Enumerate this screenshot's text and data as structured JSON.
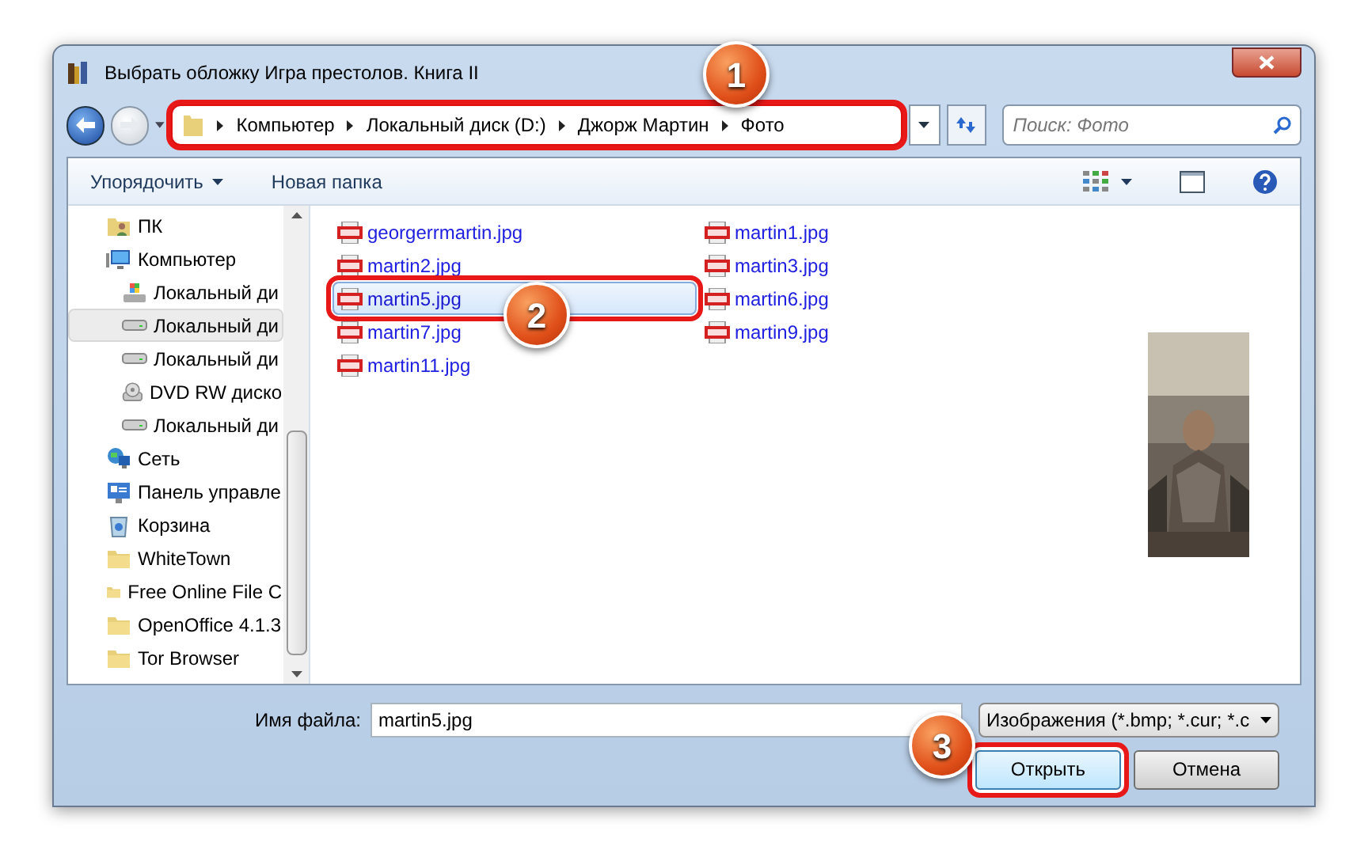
{
  "window": {
    "title": "Выбрать обложку Игра престолов. Книга II"
  },
  "address": {
    "highlighted": true,
    "segments": [
      "Компьютер",
      "Локальный диск (D:)",
      "Джорж Мартин",
      "Фото"
    ]
  },
  "search": {
    "placeholder": "Поиск: Фото"
  },
  "toolbar": {
    "organize": "Упорядочить",
    "new_folder": "Новая папка"
  },
  "sidebar": {
    "items": [
      {
        "label": "ПК",
        "kind": "user",
        "selected": false
      },
      {
        "label": "Компьютер",
        "kind": "computer",
        "selected": false,
        "children": [
          {
            "label": "Локальный ди",
            "kind": "system",
            "selected": false
          },
          {
            "label": "Локальный ди",
            "kind": "drive",
            "selected": true
          },
          {
            "label": "Локальный ди",
            "kind": "drive",
            "selected": false
          },
          {
            "label": "DVD RW диско",
            "kind": "dvd",
            "selected": false
          },
          {
            "label": "Локальный ди",
            "kind": "drive",
            "selected": false
          }
        ]
      },
      {
        "label": "Сеть",
        "kind": "network",
        "selected": false
      },
      {
        "label": "Панель управле",
        "kind": "panel",
        "selected": false
      },
      {
        "label": "Корзина",
        "kind": "bin",
        "selected": false
      },
      {
        "label": "WhiteTown",
        "kind": "folder",
        "selected": false
      },
      {
        "label": "Free Online File C",
        "kind": "folder",
        "selected": false
      },
      {
        "label": "OpenOffice 4.1.3",
        "kind": "folder",
        "selected": false
      },
      {
        "label": "Tor Browser",
        "kind": "folder",
        "selected": false
      }
    ]
  },
  "files": [
    {
      "name": "georgerrmartin.jpg",
      "selected": false,
      "highlighted": false
    },
    {
      "name": "martin2.jpg",
      "selected": false,
      "highlighted": false
    },
    {
      "name": "martin5.jpg",
      "selected": true,
      "highlighted": true
    },
    {
      "name": "martin7.jpg",
      "selected": false,
      "highlighted": false
    },
    {
      "name": "martin11.jpg",
      "selected": false,
      "highlighted": false
    },
    {
      "name": "martin1.jpg",
      "selected": false,
      "highlighted": false
    },
    {
      "name": "martin3.jpg",
      "selected": false,
      "highlighted": false
    },
    {
      "name": "martin6.jpg",
      "selected": false,
      "highlighted": false
    },
    {
      "name": "martin9.jpg",
      "selected": false,
      "highlighted": false
    }
  ],
  "preview": {
    "kind": "picture"
  },
  "filename": {
    "label": "Имя файла:",
    "value": "martin5.jpg"
  },
  "filter": {
    "value": "Изображения (*.bmp; *.cur; *.c"
  },
  "buttons": [
    {
      "label": "Открыть",
      "highlighted": true
    },
    {
      "label": "Отмена",
      "highlighted": false
    }
  ],
  "callouts": [
    "1",
    "2",
    "3"
  ]
}
